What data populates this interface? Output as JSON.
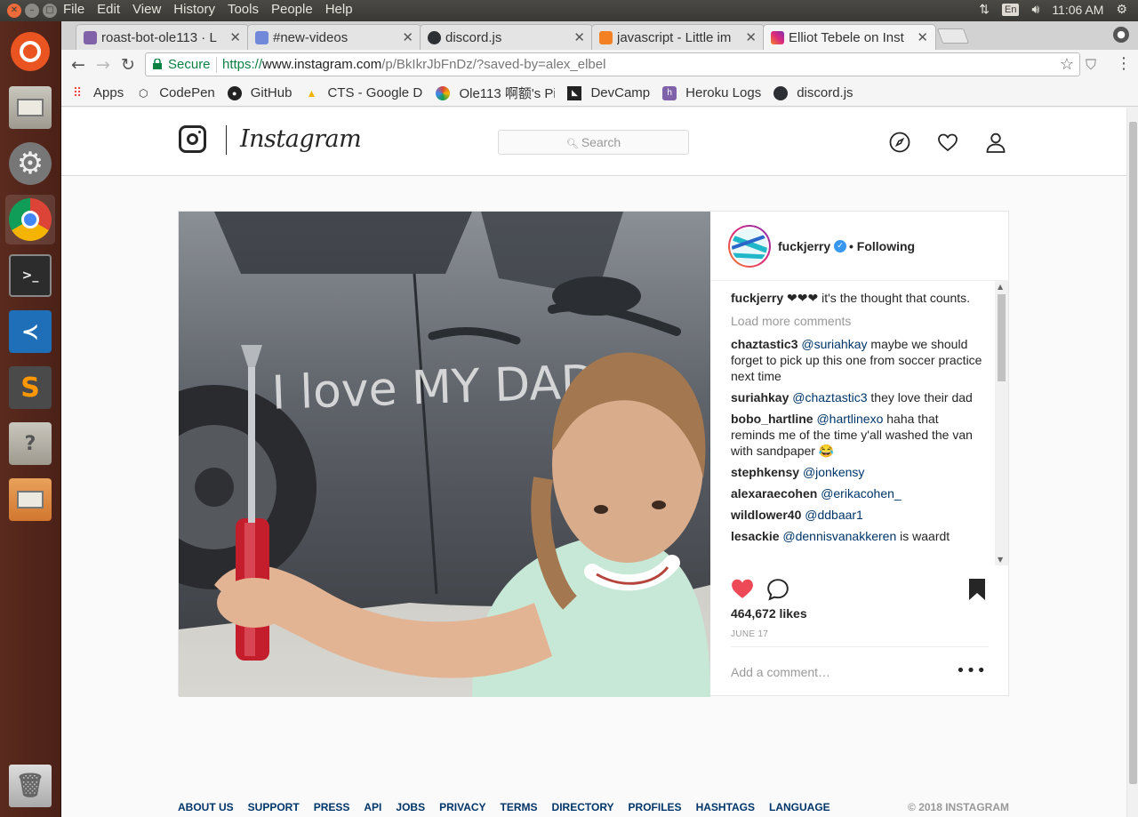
{
  "top_panel": {
    "menus": [
      "File",
      "Edit",
      "View",
      "History",
      "Tools",
      "People",
      "Help"
    ],
    "lang": "En",
    "clock": "11:06 AM"
  },
  "tabs": [
    {
      "title": "roast-bot-ole113 · L",
      "icon": "heroku-icon",
      "active": false
    },
    {
      "title": "#new-videos",
      "icon": "discord-icon",
      "active": false
    },
    {
      "title": "discord.js",
      "icon": "discordjs-icon",
      "active": false
    },
    {
      "title": "javascript - Little im",
      "icon": "stackoverflow-icon",
      "active": false
    },
    {
      "title": "Elliot Tebele on Inst",
      "icon": "instagram-icon",
      "active": true
    }
  ],
  "omnibox": {
    "secure_label": "Secure",
    "scheme": "https://",
    "host": "www.instagram.com",
    "path": "/p/BkIkrJbFnDz/?saved-by=alex_elbel"
  },
  "bookmarks": [
    {
      "label": "Apps",
      "icon": "apps-grid-icon"
    },
    {
      "label": "CodePen",
      "icon": "codepen-icon"
    },
    {
      "label": "GitHub",
      "icon": "github-icon"
    },
    {
      "label": "CTS - Google Dri",
      "icon": "google-drive-icon"
    },
    {
      "label": "Ole113 啊额's Pi",
      "icon": "picasa-icon"
    },
    {
      "label": "DevCamp",
      "icon": "devcamp-icon"
    },
    {
      "label": "Heroku Logs",
      "icon": "heroku-icon"
    },
    {
      "label": "discord.js",
      "icon": "discordjs-icon"
    }
  ],
  "instagram": {
    "wordmark": "Instagram",
    "search_placeholder": "Search",
    "post": {
      "author": "fuckjerry",
      "following": "• Following",
      "caption_user": "fuckjerry",
      "caption_text": "❤❤❤ it's the thought that counts.",
      "load_more": "Load more comments",
      "comments": [
        {
          "user": "chaztastic3",
          "mention": "@suriahkay",
          "text": "maybe we should forget to pick up this one from soccer practice next time"
        },
        {
          "user": "suriahkay",
          "mention": "@chaztastic3",
          "text": "they love their dad"
        },
        {
          "user": "bobo_hartline",
          "mention": "@hartlinexo",
          "text": "haha that reminds me of the time y'all washed the van with sandpaper 😂"
        },
        {
          "user": "stephkensy",
          "mention": "@jonkensy",
          "text": ""
        },
        {
          "user": "alexaraecohen",
          "mention": "@erikacohen_",
          "text": ""
        },
        {
          "user": "wildlower40",
          "mention": "@ddbaar1",
          "text": ""
        },
        {
          "user": "lesackie",
          "mention": "@dennisvanakkeren",
          "text": "is waardt"
        }
      ],
      "likes": "464,672 likes",
      "date": "JUNE 17",
      "add_comment_placeholder": "Add a comment…",
      "photo_scrawl": "I love MY DAD"
    },
    "footer_links": [
      "ABOUT US",
      "SUPPORT",
      "PRESS",
      "API",
      "JOBS",
      "PRIVACY",
      "TERMS",
      "DIRECTORY",
      "PROFILES",
      "HASHTAGS",
      "LANGUAGE"
    ],
    "copyright": "© 2018 INSTAGRAM"
  },
  "colors": {
    "launcher_bg": "#4b2117",
    "instagram_like_red": "#ed4956",
    "link_blue": "#003569",
    "secure_green": "#0b8043"
  }
}
